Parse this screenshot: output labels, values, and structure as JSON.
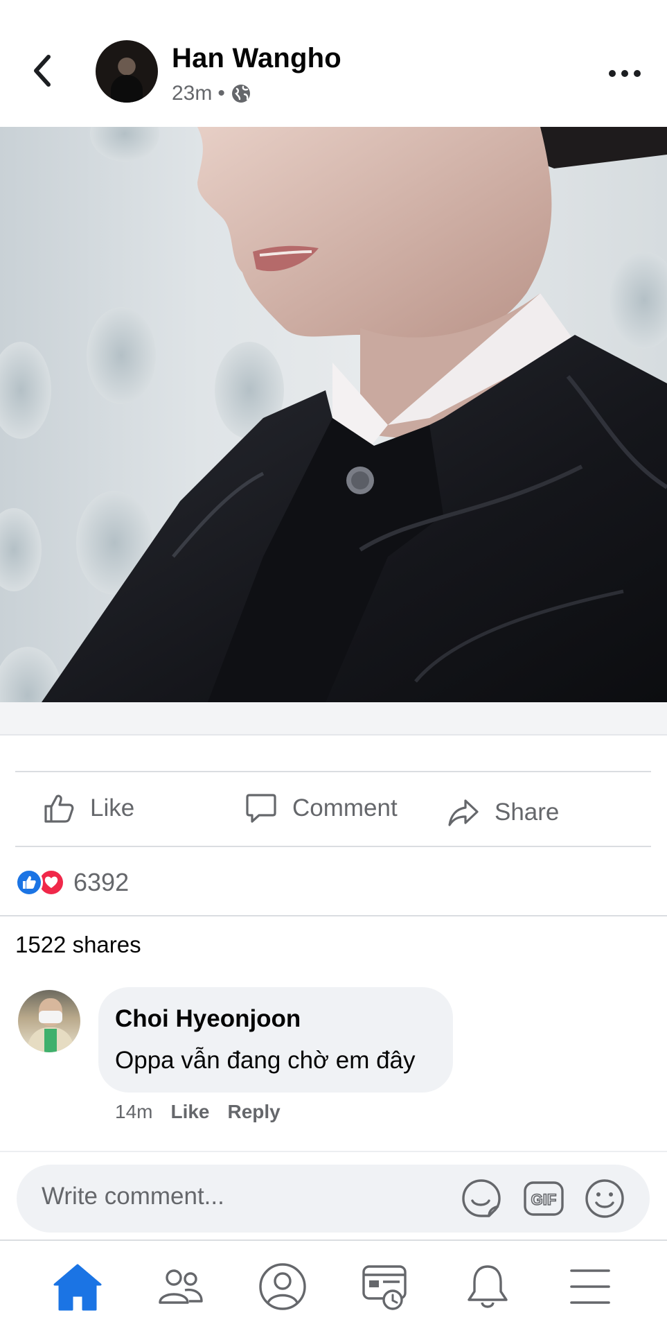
{
  "header": {
    "author": "Han Wangho",
    "time": "23m",
    "separator": "•"
  },
  "icons": {
    "back": "chevron-left-icon",
    "privacy": "globe-icon",
    "more": "more-horizontal-icon"
  },
  "actions": {
    "like": "Like",
    "comment": "Comment",
    "share": "Share"
  },
  "reactions": {
    "count": "6392",
    "types": [
      "like",
      "love"
    ]
  },
  "shares": "1522 shares",
  "comment": {
    "author": "Choi Hyeonjoon",
    "text": "Oppa vẫn đang chờ em đây",
    "time": "14m",
    "like": "Like",
    "reply": "Reply"
  },
  "composer": {
    "placeholder": "Write comment..."
  },
  "colors": {
    "accent": "#1b74e4",
    "love": "#f0284a",
    "secondary_text": "#65676b",
    "bubble": "#f0f2f5"
  }
}
